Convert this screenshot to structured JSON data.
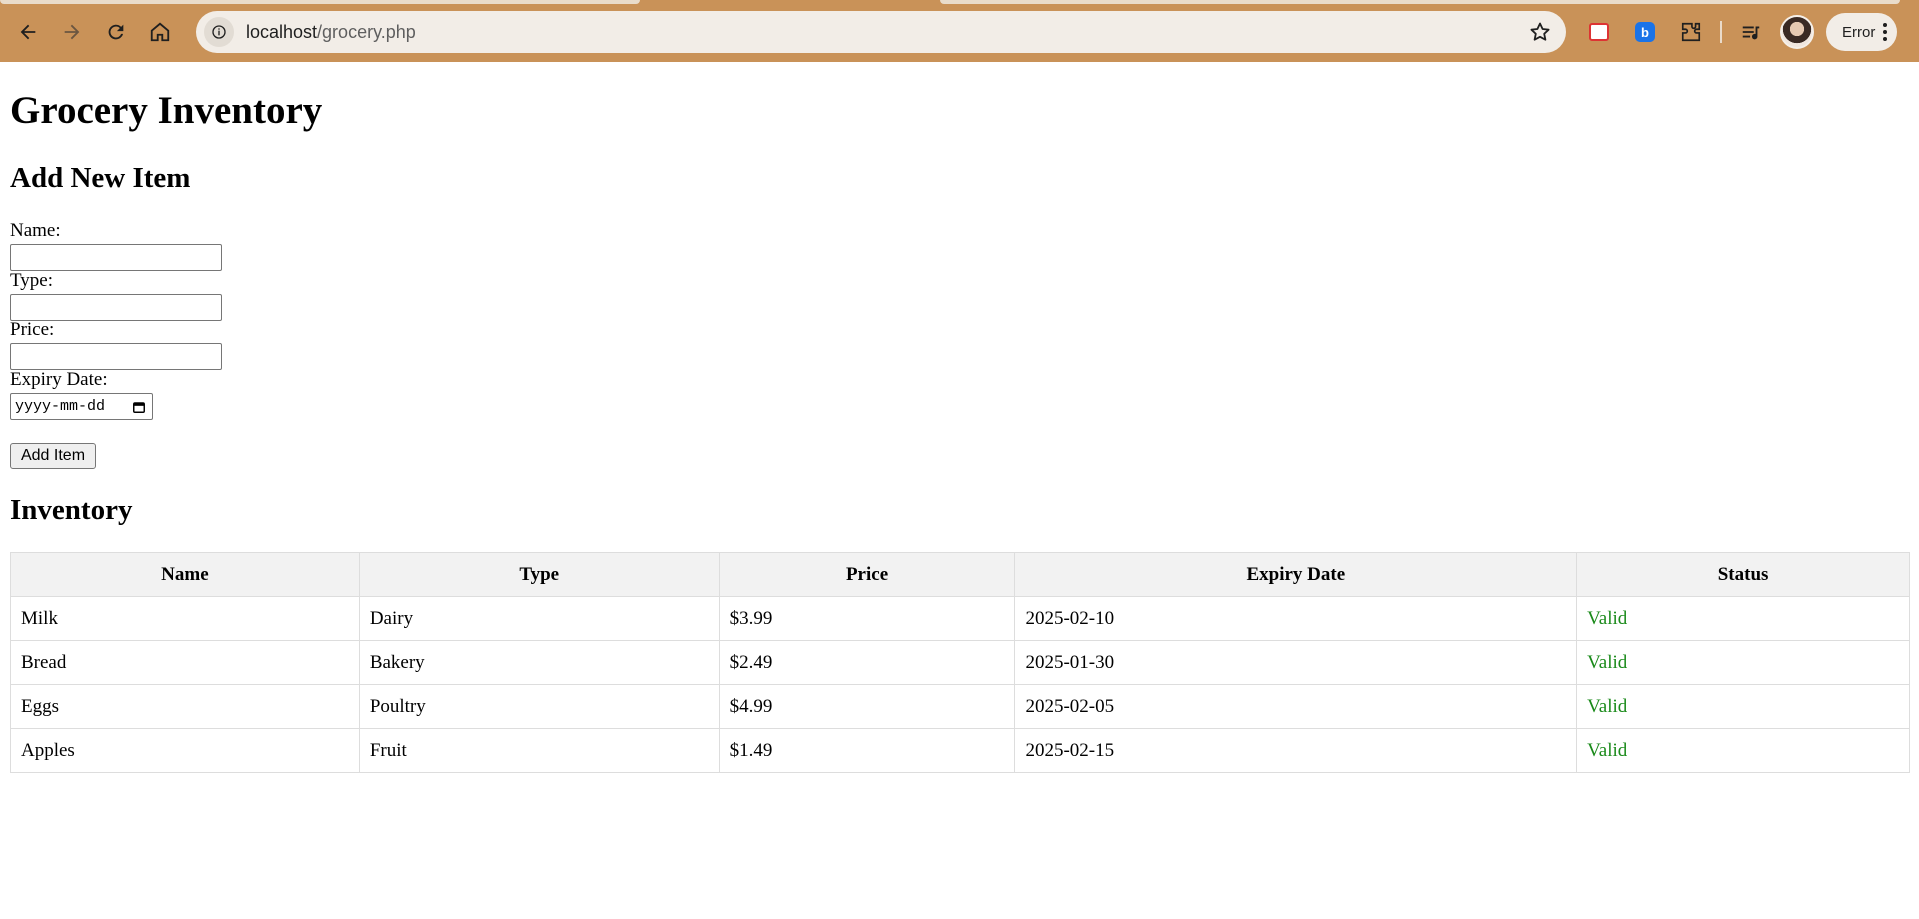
{
  "browser": {
    "url_host": "localhost",
    "url_path": "/grocery.php",
    "profile_status": "Error"
  },
  "page": {
    "title": "Grocery Inventory",
    "form": {
      "heading": "Add New Item",
      "name_label": "Name:",
      "type_label": "Type:",
      "price_label": "Price:",
      "expiry_label": "Expiry Date:",
      "date_placeholder": "yyyy-mm-dd",
      "submit_label": "Add Item"
    },
    "inventory": {
      "heading": "Inventory",
      "columns": [
        "Name",
        "Type",
        "Price",
        "Expiry Date",
        "Status"
      ],
      "rows": [
        {
          "name": "Milk",
          "type": "Dairy",
          "price": "$3.99",
          "expiry": "2025-02-10",
          "status": "Valid"
        },
        {
          "name": "Bread",
          "type": "Bakery",
          "price": "$2.49",
          "expiry": "2025-01-30",
          "status": "Valid"
        },
        {
          "name": "Eggs",
          "type": "Poultry",
          "price": "$4.99",
          "expiry": "2025-02-05",
          "status": "Valid"
        },
        {
          "name": "Apples",
          "type": "Fruit",
          "price": "$1.49",
          "expiry": "2025-02-15",
          "status": "Valid"
        }
      ]
    }
  },
  "colors": {
    "chrome_bg": "#c99258",
    "status_valid": "#1a8a1a",
    "table_header_bg": "#f2f2f2"
  }
}
